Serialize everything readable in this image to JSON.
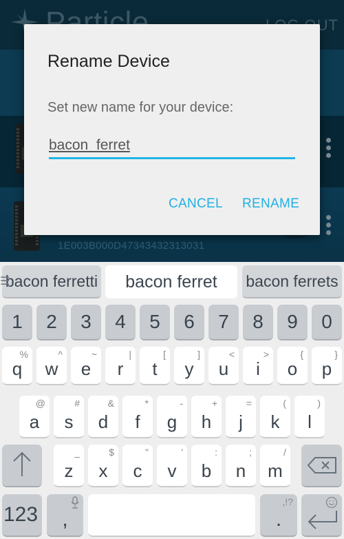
{
  "app": {
    "logo_text": "Particle",
    "logout_label": "LOG OUT",
    "devices": [
      {
        "id_text": ""
      },
      {
        "id_text": ""
      },
      {
        "id_text": "1E003B000D47343432313031"
      }
    ]
  },
  "dialog": {
    "title": "Rename Device",
    "message": "Set new name for your device:",
    "input_value": "bacon_ferret",
    "cancel_label": "CANCEL",
    "rename_label": "RENAME",
    "accent_color": "#1fb5e8"
  },
  "keyboard": {
    "suggestions": [
      "bacon ferretti",
      "bacon ferret",
      "bacon ferrets"
    ],
    "number_row": [
      "1",
      "2",
      "3",
      "4",
      "5",
      "6",
      "7",
      "8",
      "9",
      "0"
    ],
    "row1": [
      {
        "key": "q",
        "alt": "%"
      },
      {
        "key": "w",
        "alt": "^"
      },
      {
        "key": "e",
        "alt": "~"
      },
      {
        "key": "r",
        "alt": "|"
      },
      {
        "key": "t",
        "alt": "["
      },
      {
        "key": "y",
        "alt": "]"
      },
      {
        "key": "u",
        "alt": "<"
      },
      {
        "key": "i",
        "alt": ">"
      },
      {
        "key": "o",
        "alt": "{"
      },
      {
        "key": "p",
        "alt": "}"
      }
    ],
    "row2": [
      {
        "key": "a",
        "alt": "@"
      },
      {
        "key": "s",
        "alt": "#"
      },
      {
        "key": "d",
        "alt": "&"
      },
      {
        "key": "f",
        "alt": "*"
      },
      {
        "key": "g",
        "alt": "-"
      },
      {
        "key": "h",
        "alt": "+"
      },
      {
        "key": "j",
        "alt": "="
      },
      {
        "key": "k",
        "alt": "("
      },
      {
        "key": "l",
        "alt": ")"
      }
    ],
    "row3": [
      {
        "key": "z",
        "alt": "_"
      },
      {
        "key": "x",
        "alt": "$"
      },
      {
        "key": "c",
        "alt": "\""
      },
      {
        "key": "v",
        "alt": "'"
      },
      {
        "key": "b",
        "alt": ":"
      },
      {
        "key": "n",
        "alt": ";"
      },
      {
        "key": "m",
        "alt": "/"
      }
    ],
    "symbols_label": "123",
    "comma_label": ",",
    "period_label": ".",
    "period_alt": ",!?"
  }
}
